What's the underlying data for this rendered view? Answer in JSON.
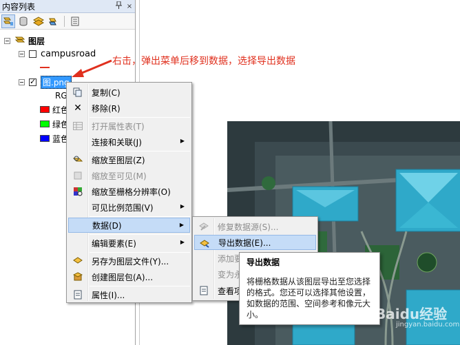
{
  "panel": {
    "title": "内容列表",
    "pin": "ᵖ",
    "close": "×"
  },
  "tree": {
    "root_label": "图层",
    "layer1_label": "campusroad",
    "layer2_label": "图.png",
    "rgb_label": "RG",
    "legend": [
      {
        "label": "红色",
        "color": "#ff0000"
      },
      {
        "label": "绿色",
        "color": "#00ff00"
      },
      {
        "label": "蓝色",
        "color": "#0000ff"
      }
    ]
  },
  "annotation": "右击，弹出菜单后移到数据，选择导出数据",
  "context_menu": {
    "items": [
      {
        "label": "复制(C)",
        "icon": "copy-icon",
        "disabled": false
      },
      {
        "label": "移除(R)",
        "icon": "remove-icon",
        "disabled": false
      },
      {
        "label": "打开属性表(T)",
        "icon": "table-icon",
        "disabled": true
      },
      {
        "label": "连接和关联(J)",
        "icon": "",
        "disabled": false,
        "submenu": true
      },
      {
        "label": "缩放至图层(Z)",
        "icon": "zoom-layer-icon",
        "disabled": false
      },
      {
        "label": "缩放至可见(M)",
        "icon": "zoom-visible-icon",
        "disabled": true
      },
      {
        "label": "缩放至栅格分辨率(O)",
        "icon": "raster-resolution-icon",
        "disabled": false
      },
      {
        "label": "可见比例范围(V)",
        "icon": "",
        "disabled": false,
        "submenu": true
      },
      {
        "label": "数据(D)",
        "icon": "",
        "disabled": false,
        "submenu": true,
        "highlighted": true
      },
      {
        "label": "编辑要素(E)",
        "icon": "",
        "disabled": false,
        "submenu": true
      },
      {
        "label": "另存为图层文件(Y)...",
        "icon": "layer-file-icon",
        "disabled": false
      },
      {
        "label": "创建图层包(A)...",
        "icon": "layer-package-icon",
        "disabled": false
      },
      {
        "label": "属性(I)...",
        "icon": "properties-icon",
        "disabled": false
      }
    ]
  },
  "submenu": {
    "items": [
      {
        "label": "修复数据源(S)...",
        "disabled": true
      },
      {
        "label": "导出数据(E)...",
        "disabled": false,
        "highlighted": true
      },
      {
        "label": "添加要",
        "disabled": true
      },
      {
        "label": "变为永",
        "disabled": true
      },
      {
        "label": "查看项",
        "disabled": false
      }
    ]
  },
  "tooltip": {
    "title": "导出数据",
    "body": "将栅格数据从该图层导出至您选择的格式。您还可以选择其他设置，如数据的范围、空间参考和像元大小。"
  },
  "watermark": {
    "main": "Baidu经验",
    "sub": "jingyan.baidu.com"
  },
  "colors": {
    "accent_red": "#e0301e",
    "selection_blue": "#3399ff",
    "menu_highlight": "#c5dcf7"
  }
}
